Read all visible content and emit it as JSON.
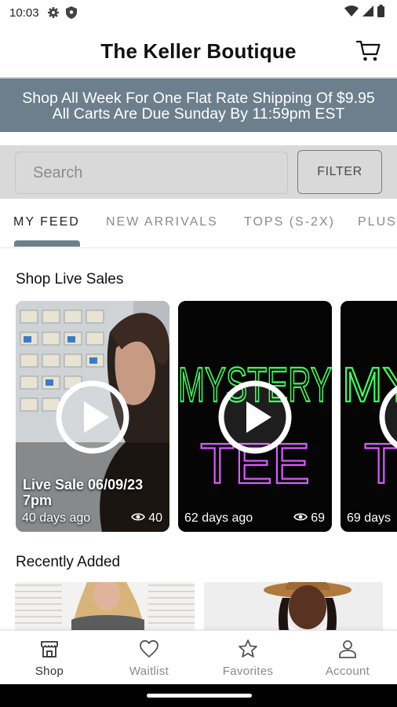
{
  "status_bar": {
    "time": "10:03",
    "left_icons": [
      "gear-icon",
      "shield-icon"
    ],
    "right_icons": [
      "wifi-icon",
      "signal-icon",
      "battery-icon"
    ]
  },
  "header": {
    "title": "The Keller Boutique",
    "cart_icon": "cart-icon"
  },
  "banner": {
    "line1": "Shop All Week For One Flat Rate Shipping Of $9.95",
    "line2": "All Carts Are Due Sunday By 11:59pm EST",
    "color": "#6d7f8c"
  },
  "search": {
    "placeholder": "Search",
    "filter_label": "FILTER"
  },
  "tabs": [
    {
      "label": "MY FEED",
      "active": true
    },
    {
      "label": "NEW ARRIVALS",
      "active": false
    },
    {
      "label": "TOPS (S-2X)",
      "active": false
    },
    {
      "label": "PLUS",
      "active": false
    }
  ],
  "live_sales": {
    "title": "Shop Live Sales",
    "cards": [
      {
        "title": "Live Sale 06/09/23 7pm",
        "age": "40 days ago",
        "views": "40"
      },
      {
        "title": "",
        "neon_line1": "MYSTERY",
        "neon_line2": "TEE",
        "age": "62 days ago",
        "views": "69"
      },
      {
        "title": "",
        "neon_line1": "MYS",
        "neon_line2": "T",
        "age": "69 days",
        "views": ""
      }
    ]
  },
  "recently_added": {
    "title": "Recently Added"
  },
  "bottom_nav": [
    {
      "label": "Shop",
      "icon": "shop-icon",
      "active": true
    },
    {
      "label": "Waitlist",
      "icon": "heart-icon",
      "active": false
    },
    {
      "label": "Favorites",
      "icon": "star-icon",
      "active": false
    },
    {
      "label": "Account",
      "icon": "person-icon",
      "active": false
    }
  ]
}
